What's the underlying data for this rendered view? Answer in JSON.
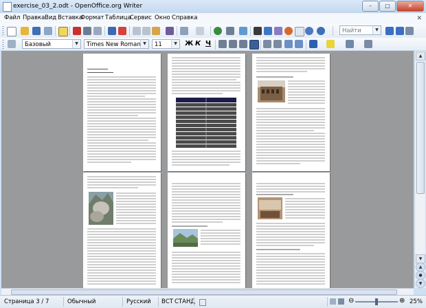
{
  "window": {
    "title": "exercise_03_2.odt - OpenOffice.org Writer",
    "buttons": [
      "–",
      "□",
      "✕"
    ]
  },
  "menu": [
    "Файл",
    "Правка",
    "Вид",
    "Вставка",
    "Формат",
    "Таблица",
    "Сервис",
    "Окно",
    "Справка"
  ],
  "menu_close_glyph": "✕",
  "standard_toolbar": {
    "find_placeholder": "Найти"
  },
  "format_toolbar": {
    "paragraph_style": "Базовый",
    "font_name": "Times New Roman",
    "font_size": "11",
    "bold": "Ж",
    "italic": "К",
    "underline": "Ч"
  },
  "statusbar": {
    "page": "Страница  3 / 7",
    "page_style": "Обычный",
    "language": "Русский",
    "insert_mode": "ВСТ",
    "selection_mode": "СТАНД",
    "zoom": "25%"
  },
  "colors": {
    "workspace": "#999a9c",
    "chrome": "#dbe6f3",
    "table_header": "#1c1c4a"
  }
}
